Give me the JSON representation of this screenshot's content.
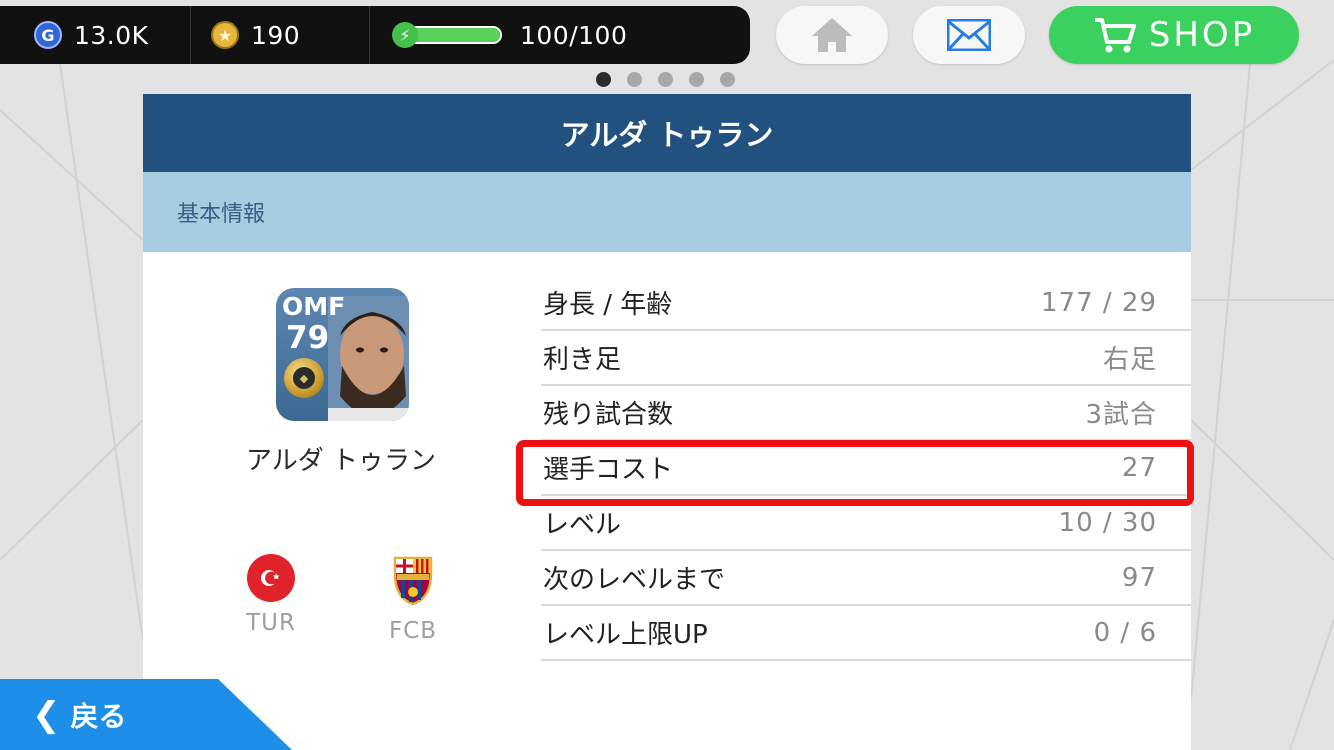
{
  "status": {
    "gp_amount": "13.0K",
    "coin_amount": "190",
    "energy_text": "100/100",
    "energy_fraction": 1.0,
    "gp_icon_letter": "G",
    "coin_icon_glyph": "★"
  },
  "top_buttons": {
    "home_icon": "home-icon",
    "mail_icon": "mail-icon",
    "shop_label": "SHOP"
  },
  "pager": {
    "total": 5,
    "active_index": 0
  },
  "card": {
    "title": "アルダ トゥラン",
    "section_label": "基本情報"
  },
  "player": {
    "position": "OMF",
    "rating": "79",
    "name": "アルダ トゥラン",
    "nation_code": "TUR",
    "club_code": "FCB"
  },
  "stats": [
    {
      "label": "身長 / 年齢",
      "value": "177 / 29"
    },
    {
      "label": "利き足",
      "value": "右足"
    },
    {
      "label": "残り試合数",
      "value": "3試合"
    },
    {
      "label": "選手コスト",
      "value": "27"
    },
    {
      "label": "レベル",
      "value": "10 / 30"
    },
    {
      "label": "次のレベルまで",
      "value": "97"
    },
    {
      "label": "レベル上限UP",
      "value": "0 / 6"
    }
  ],
  "highlighted_stat_index": 3,
  "back_button": {
    "label": "戻る"
  },
  "colors": {
    "header_blue": "#22507f",
    "section_blue": "#a5cce0",
    "shop_green": "#3ad15e",
    "back_blue": "#1d8fe8",
    "highlight_red": "#ee1111"
  }
}
